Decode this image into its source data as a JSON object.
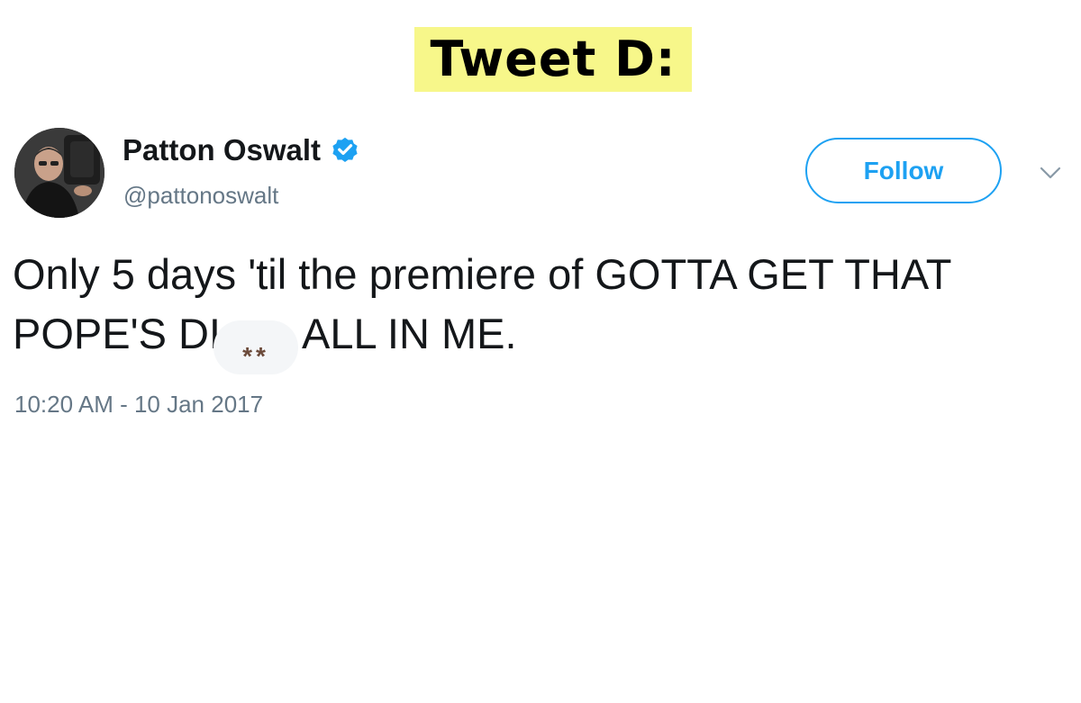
{
  "heading": {
    "text": "Tweet D:",
    "highlight_color": "#f7f78a"
  },
  "tweet": {
    "author": {
      "display_name": "Patton Oswalt",
      "handle": "@pattonoswalt",
      "verified": true,
      "avatar_icon": "profile-photo"
    },
    "follow_button": {
      "label": "Follow",
      "color": "#1da1f2"
    },
    "menu_icon": "chevron-down-icon",
    "text": {
      "part1": "Only 5 days 'til the premiere of GOTTA GET THAT POPE'S DI",
      "censored": "**",
      "part2": "ALL IN ME."
    },
    "timestamp": "10:20 AM - 10 Jan 2017"
  }
}
